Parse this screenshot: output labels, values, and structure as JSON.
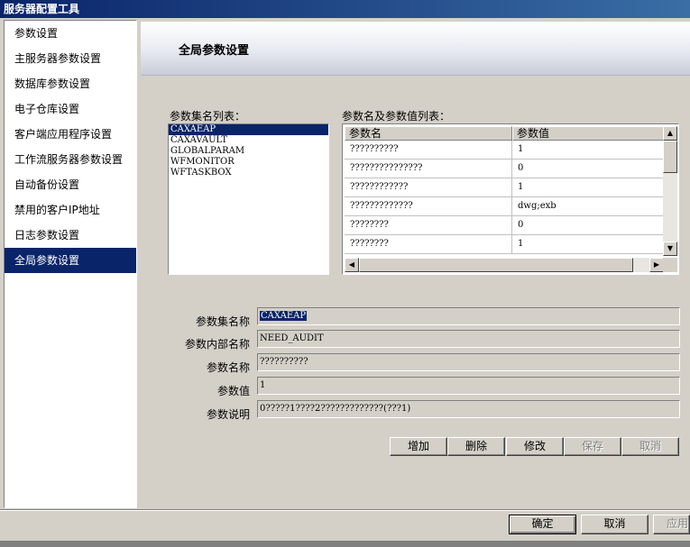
{
  "window": {
    "title": "服务器配置工具"
  },
  "sidebar": {
    "items": [
      {
        "label": "参数设置"
      },
      {
        "label": "主服务器参数设置"
      },
      {
        "label": "数据库参数设置"
      },
      {
        "label": "电子仓库设置"
      },
      {
        "label": "客户端应用程序设置"
      },
      {
        "label": "工作流服务器参数设置"
      },
      {
        "label": "自动备份设置"
      },
      {
        "label": "禁用的客户IP地址"
      },
      {
        "label": "日志参数设置"
      },
      {
        "label": "全局参数设置",
        "selected": true
      }
    ]
  },
  "header": {
    "title": "全局参数设置"
  },
  "set_list": {
    "label": "参数集名列表：",
    "items": [
      "CAXAEAP",
      "CAXAVAULT",
      "GLOBALPARAM",
      "WFMONITOR",
      "WFTASKBOX"
    ],
    "selected": "CAXAEAP"
  },
  "param_grid": {
    "label": "参数名及参数值列表：",
    "columns": [
      "参数名",
      "参数值"
    ],
    "rows": [
      [
        "??????????",
        "1"
      ],
      [
        "???????????????",
        "0"
      ],
      [
        "????????????",
        "1"
      ],
      [
        "?????????????",
        "dwg;exb"
      ],
      [
        "????????",
        "0"
      ],
      [
        "????????",
        "1"
      ]
    ]
  },
  "form": {
    "set_name": {
      "label": "参数集名称",
      "value": "CAXAEAP"
    },
    "internal_name": {
      "label": "参数内部名称",
      "value": "NEED_AUDIT"
    },
    "param_name": {
      "label": "参数名称",
      "value": "??????????"
    },
    "param_value": {
      "label": "参数值",
      "value": "1"
    },
    "param_desc": {
      "label": "参数说明",
      "value": "0?????1????2?????????????(???1)"
    }
  },
  "actions": {
    "add": "增加",
    "delete": "删除",
    "modify": "修改",
    "save": "保存",
    "cancel": "取消"
  },
  "dialog_buttons": {
    "ok": "确定",
    "cancel": "取消",
    "apply": "应用"
  }
}
